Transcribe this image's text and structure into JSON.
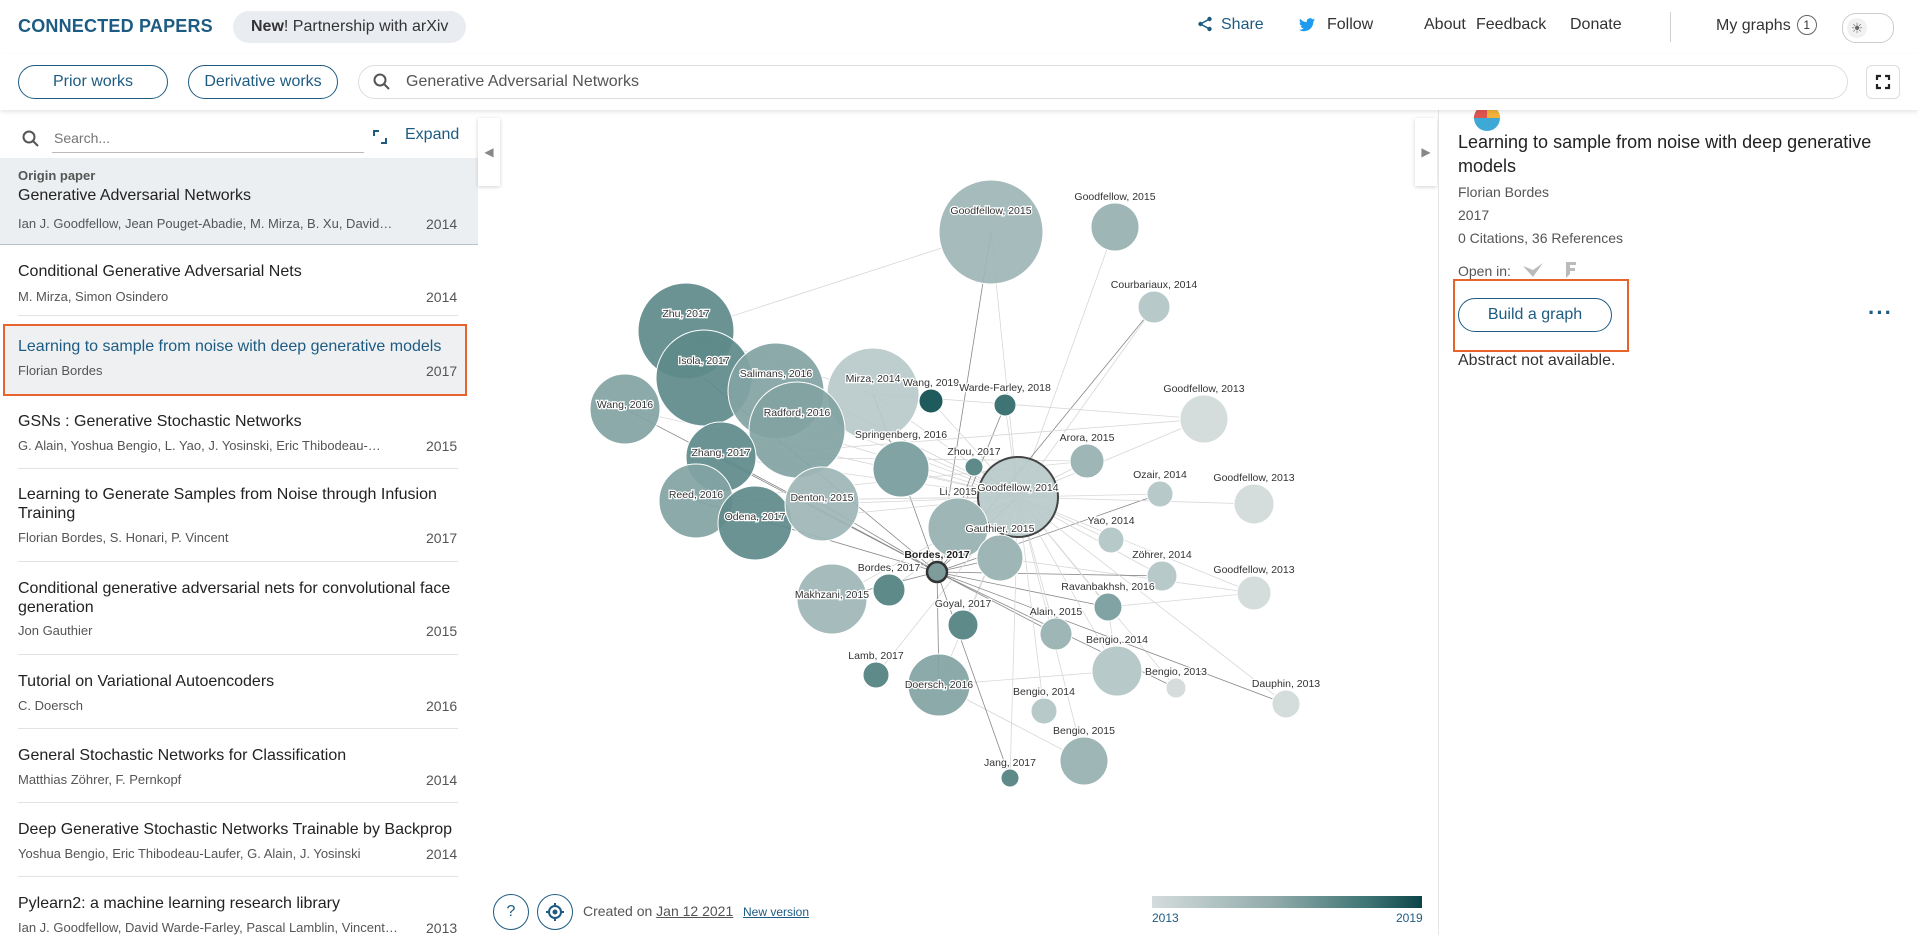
{
  "header": {
    "brand": "CONNECTED PAPERS",
    "promo_new": "New",
    "promo_rest": "! Partnership with arXiv",
    "nav": {
      "share": "Share",
      "follow": "Follow",
      "about": "About",
      "feedback": "Feedback",
      "donate": "Donate",
      "my_graphs": "My graphs",
      "my_graphs_count": "1"
    }
  },
  "toolbar": {
    "prior_works": "Prior works",
    "derivative_works": "Derivative works",
    "search_value": "Generative Adversarial Networks"
  },
  "list": {
    "search_placeholder": "Search...",
    "expand": "Expand",
    "origin_label": "Origin paper",
    "origin": {
      "title": "Generative Adversarial Networks",
      "authors": "Ian J. Goodfellow, Jean Pouget-Abadie, M. Mirza, B. Xu, David…",
      "year": "2014"
    },
    "items": [
      {
        "title": "Conditional Generative Adversarial Nets",
        "authors": "M. Mirza, Simon Osindero",
        "year": "2014"
      },
      {
        "title": "Learning to sample from noise with deep generative models",
        "authors": "Florian Bordes",
        "year": "2017"
      },
      {
        "title": "GSNs : Generative Stochastic Networks",
        "authors": "G. Alain, Yoshua Bengio, L. Yao, J. Yosinski, Eric Thibodeau-…",
        "year": "2015"
      },
      {
        "title": "Learning to Generate Samples from Noise through Infusion Training",
        "authors": "Florian Bordes, S. Honari, P. Vincent",
        "year": "2017"
      },
      {
        "title": "Conditional generative adversarial nets for convolutional face generation",
        "authors": "Jon Gauthier",
        "year": "2015"
      },
      {
        "title": "Tutorial on Variational Autoencoders",
        "authors": "C. Doersch",
        "year": "2016"
      },
      {
        "title": "General Stochastic Networks for Classification",
        "authors": "Matthias Zöhrer, F. Pernkopf",
        "year": "2014"
      },
      {
        "title": "Deep Generative Stochastic Networks Trainable by Backprop",
        "authors": "Yoshua Bengio, Eric Thibodeau-Laufer, G. Alain, J. Yosinski",
        "year": "2014"
      },
      {
        "title": "Pylearn2: a machine learning research library",
        "authors": "Ian J. Goodfellow, David Warde-Farley, Pascal Lamblin, Vincent…",
        "year": "2013"
      }
    ]
  },
  "graph": {
    "nodes": [
      {
        "label": "Goodfellow, 2015",
        "year": 2015
      },
      {
        "label": "Goodfellow, 2015",
        "year": 2015
      },
      {
        "label": "Courbariaux, 2014",
        "year": 2014
      },
      {
        "label": "Zhu, 2017",
        "year": 2017
      },
      {
        "label": "Isola, 2017",
        "year": 2017
      },
      {
        "label": "Salimans, 2016",
        "year": 2016
      },
      {
        "label": "Mirza, 2014",
        "year": 2014
      },
      {
        "label": "Wang, 2019",
        "year": 2019
      },
      {
        "label": "Warde-Farley, 2018",
        "year": 2018
      },
      {
        "label": "Goodfellow, 2013",
        "year": 2013
      },
      {
        "label": "Wang, 2016",
        "year": 2016
      },
      {
        "label": "Radford, 2016",
        "year": 2016
      },
      {
        "label": "Zhang, 2017",
        "year": 2017
      },
      {
        "label": "Springenberg, 2016",
        "year": 2016
      },
      {
        "label": "Zhou, 2017",
        "year": 2017
      },
      {
        "label": "Arora, 2015",
        "year": 2015
      },
      {
        "label": "Ozair, 2014",
        "year": 2014
      },
      {
        "label": "Goodfellow, 2013",
        "year": 2013
      },
      {
        "label": "Reed, 2016",
        "year": 2016
      },
      {
        "label": "Odena, 2017",
        "year": 2017
      },
      {
        "label": "Denton, 2015",
        "year": 2015
      },
      {
        "label": "Goodfellow, 2014",
        "year": 2014
      },
      {
        "label": "Li, 2015",
        "year": 2015
      },
      {
        "label": "Yao, 2014",
        "year": 2014
      },
      {
        "label": "Gauthier, 2015",
        "year": 2015
      },
      {
        "label": "Bordes, 2017",
        "year": 2017
      },
      {
        "label": "Zöhrer, 2014",
        "year": 2014
      },
      {
        "label": "Goodfellow, 2013",
        "year": 2013
      },
      {
        "label": "Makhzani, 2015",
        "year": 2015
      },
      {
        "label": "Bordes, 2017",
        "year": 2017
      },
      {
        "label": "Ravanbakhsh, 2016",
        "year": 2016
      },
      {
        "label": "Goyal, 2017",
        "year": 2017
      },
      {
        "label": "Alain, 2015",
        "year": 2015
      },
      {
        "label": "Bengio, 2014",
        "year": 2014
      },
      {
        "label": "Bengio, 2013",
        "year": 2013
      },
      {
        "label": "Lamb, 2017",
        "year": 2017
      },
      {
        "label": "Doersch, 2016",
        "year": 2016
      },
      {
        "label": "Bengio, 2014",
        "year": 2014
      },
      {
        "label": "Dauphin, 2013",
        "year": 2013
      },
      {
        "label": "Bengio, 2015",
        "year": 2015
      },
      {
        "label": "Jang, 2017",
        "year": 2017
      }
    ],
    "created_prefix": "Created on ",
    "created_date": "Jan 12 2021",
    "new_version": "New version",
    "legend_min": "2013",
    "legend_max": "2019"
  },
  "detail": {
    "title": "Learning to sample from noise with deep generative models",
    "author": "Florian Bordes",
    "year": "2017",
    "citations": "0 Citations, 36 References",
    "open_in": "Open in:",
    "build": "Build a graph",
    "abstract": "Abstract not available."
  },
  "colors": {
    "accent": "#1d5b82",
    "highlight": "#e8622c"
  }
}
